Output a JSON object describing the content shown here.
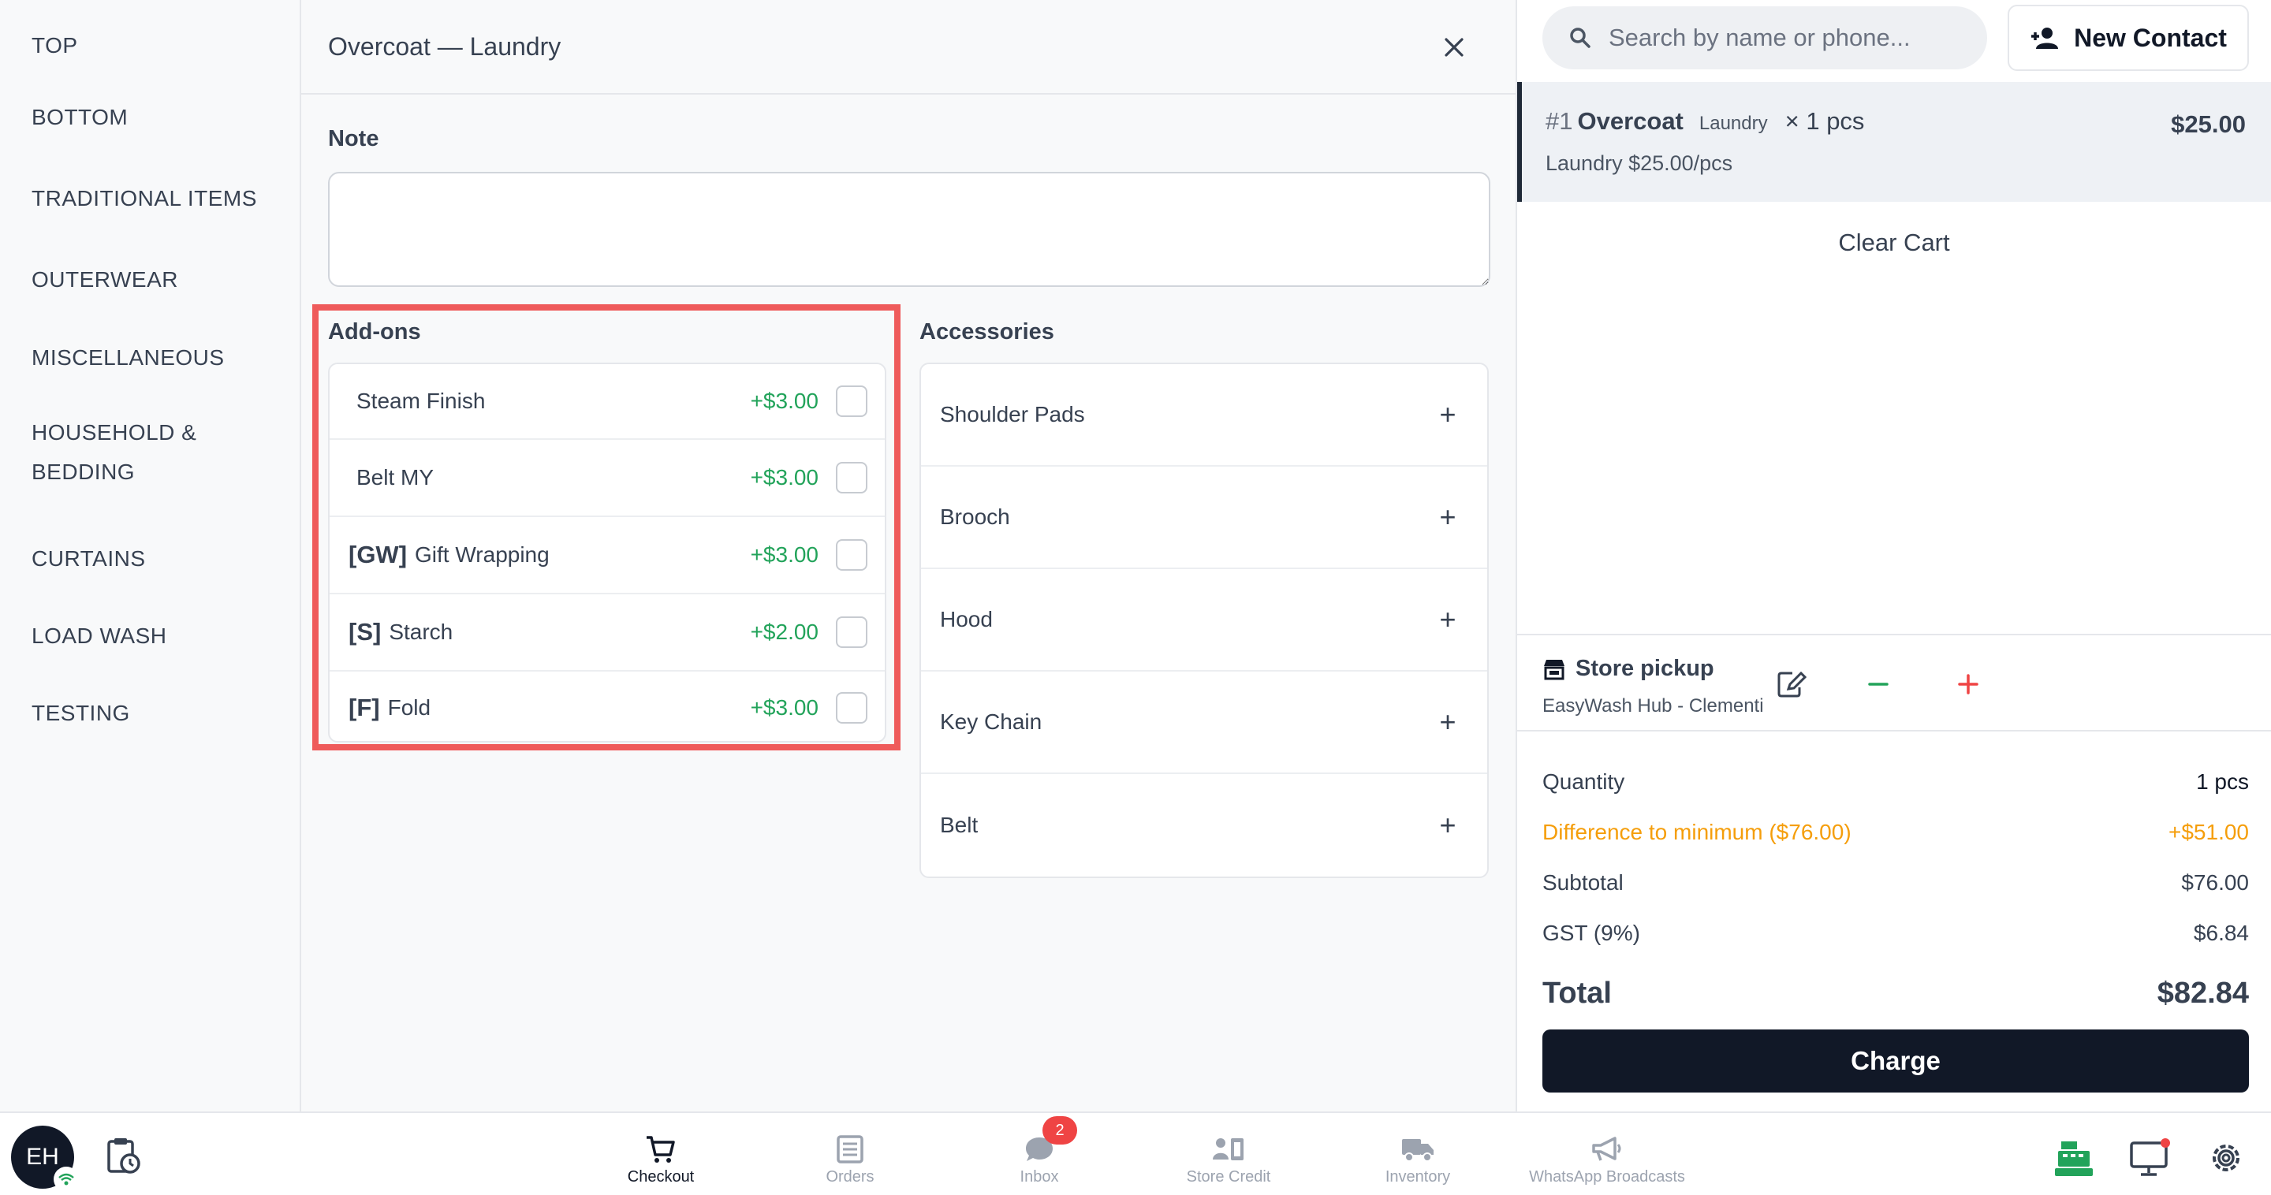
{
  "sidebar": {
    "categories": [
      "TOP",
      "BOTTOM",
      "TRADITIONAL ITEMS",
      "OUTERWEAR",
      "MISCELLANEOUS",
      "HOUSEHOLD &",
      "BEDDING",
      "CURTAINS",
      "LOAD WASH",
      "TESTING"
    ]
  },
  "detail": {
    "title": "Overcoat — Laundry",
    "close_icon": "close-icon",
    "note_label": "Note",
    "note_value": "",
    "addons_label": "Add-ons",
    "addons": [
      {
        "code": "",
        "name": "Steam Finish",
        "price": "+$3.00",
        "checked": false
      },
      {
        "code": "",
        "name": "Belt MY",
        "price": "+$3.00",
        "checked": false
      },
      {
        "code": "[GW]",
        "name": "Gift Wrapping",
        "price": "+$3.00",
        "checked": false
      },
      {
        "code": "[S]",
        "name": "Starch",
        "price": "+$2.00",
        "checked": false
      },
      {
        "code": "[F]",
        "name": "Fold",
        "price": "+$3.00",
        "checked": false
      }
    ],
    "accessories_label": "Accessories",
    "accessories": [
      {
        "name": "Shoulder Pads",
        "action": "+"
      },
      {
        "name": "Brooch",
        "action": "+"
      },
      {
        "name": "Hood",
        "action": "+"
      },
      {
        "name": "Key Chain",
        "action": "+"
      },
      {
        "name": "Belt",
        "action": "+"
      }
    ]
  },
  "cart": {
    "search_placeholder": "Search by name or phone...",
    "new_contact_label": "New Contact",
    "item": {
      "num": "#1",
      "name": "Overcoat",
      "service": "Laundry",
      "qty": "× 1 pcs",
      "price": "$25.00",
      "subline": "Laundry $25.00/pcs"
    },
    "clear_cart_label": "Clear Cart",
    "pickup": {
      "title": "Store pickup",
      "store": "EasyWash Hub - Clementi"
    },
    "summary": {
      "quantity_label": "Quantity",
      "quantity_value": "1 pcs",
      "diff_label": "Difference to minimum ($76.00)",
      "diff_value": "+$51.00",
      "subtotal_label": "Subtotal",
      "subtotal_value": "$76.00",
      "gst_label": "GST (9%)",
      "gst_value": "$6.84",
      "total_label": "Total",
      "total_value": "$82.84"
    },
    "charge_label": "Charge"
  },
  "bottombar": {
    "avatar_initials": "EH",
    "nav": [
      {
        "label": "Checkout",
        "icon": "cart-icon",
        "active": true
      },
      {
        "label": "Orders",
        "icon": "orders-icon",
        "active": false
      },
      {
        "label": "Inbox",
        "icon": "chat-icon",
        "active": false,
        "badge": "2"
      },
      {
        "label": "Store Credit",
        "icon": "store-credit-icon",
        "active": false
      },
      {
        "label": "Inventory",
        "icon": "truck-icon",
        "active": false
      },
      {
        "label": "WhatsApp Broadcasts",
        "icon": "megaphone-icon",
        "active": false
      }
    ]
  },
  "colors": {
    "accent_dark": "#111827",
    "price_green": "#22a35a",
    "warning_orange": "#f59e0b",
    "highlight_red": "#ef5b5b",
    "minus_green": "#22a35a",
    "plus_red": "#ef4444"
  }
}
